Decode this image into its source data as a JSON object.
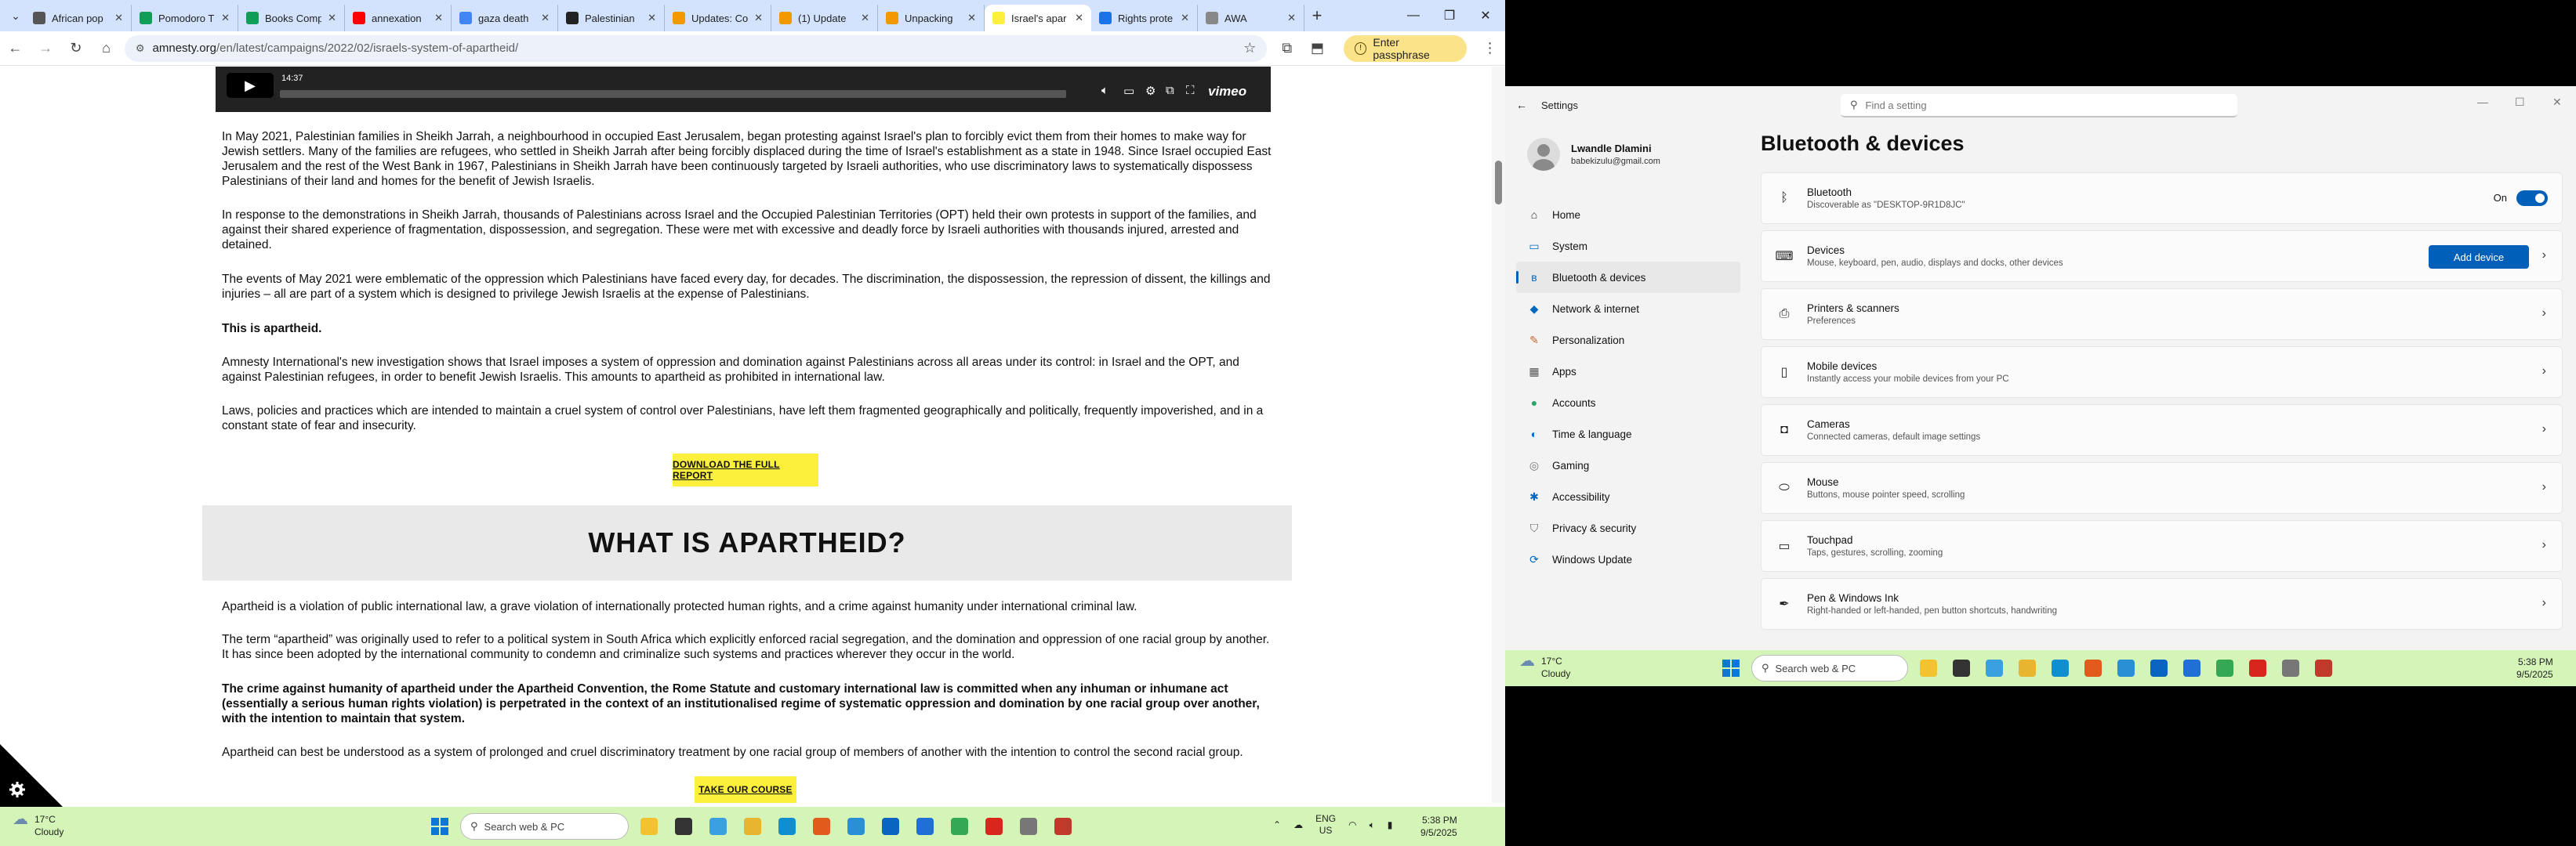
{
  "browser": {
    "tabs": [
      {
        "title": "African pop",
        "color": "#555"
      },
      {
        "title": "Pomodoro T",
        "color": "#0f9d58"
      },
      {
        "title": "Books Comp",
        "color": "#0f9d58"
      },
      {
        "title": "annexation",
        "color": "#ff0000"
      },
      {
        "title": "gaza death",
        "color": "#4285f4"
      },
      {
        "title": "Palestinian",
        "color": "#222"
      },
      {
        "title": "Updates: Co",
        "color": "#f29900"
      },
      {
        "title": "(1) Update",
        "color": "#f29900"
      },
      {
        "title": "Unpacking",
        "color": "#f29900"
      },
      {
        "title": "Israel's apar",
        "color": "#fdf03c"
      },
      {
        "title": "Rights prote",
        "color": "#1a73e8"
      },
      {
        "title": "AWA",
        "color": "#888"
      }
    ],
    "new_tab": "+",
    "url_host": "amnesty.org",
    "url_path": "/en/latest/campaigns/2022/02/israels-system-of-apartheid/",
    "passphrase_button": "Enter passphrase"
  },
  "video": {
    "time": "14:37",
    "brand": "vimeo"
  },
  "article": {
    "p1": "In May 2021, Palestinian families in Sheikh Jarrah, a neighbourhood in occupied East Jerusalem, began protesting against Israel's plan to forcibly evict them from their homes to make way for Jewish settlers. Many of the families are refugees, who settled in Sheikh Jarrah after being forcibly displaced during the time of Israel's establishment as a state in 1948.  Since Israel occupied East Jerusalem and the rest of the West Bank in 1967, Palestinians in Sheikh Jarrah have been continuously targeted by Israeli authorities, who use discriminatory laws to systematically dispossess Palestinians of their land and homes for the benefit of Jewish Israelis.",
    "p2": "In response to the demonstrations in Sheikh Jarrah, thousands of Palestinians across Israel and the Occupied Palestinian Territories (OPT) held their own protests in support of the families, and against their shared experience of fragmentation, dispossession, and segregation. These were met with excessive and deadly force by Israeli authorities with thousands injured, arrested and detained.",
    "p3": "The events of May 2021 were emblematic of the oppression which Palestinians have faced every day, for decades. The discrimination, the dispossession, the repression of dissent, the killings and injuries – all are part of a system which is designed to privilege Jewish Israelis at the expense of Palestinians.",
    "p4": "This is apartheid.",
    "p5": "Amnesty International's new investigation shows that Israel imposes a system of oppression and domination against Palestinians across all areas under its control: in Israel and the OPT, and against Palestinian refugees, in order to benefit Jewish Israelis. This amounts to apartheid as prohibited in international law.",
    "p6": "Laws, policies and practices which are intended to maintain a cruel system of control over Palestinians, have left them fragmented geographically and politically, frequently impoverished, and in a constant state of fear and insecurity.",
    "cta1": "DOWNLOAD THE FULL REPORT",
    "heading": "WHAT IS APARTHEID?",
    "p7": "Apartheid is a violation of public international law, a grave violation of internationally protected human rights, and a crime against humanity under international criminal law.",
    "p8": "The term “apartheid” was originally used to refer to a political system in South Africa which explicitly enforced racial segregation, and the domination and oppression of one racial group by another. It has since been adopted by the international community to condemn and criminalize such systems and practices wherever they occur in the world.",
    "p9": "The crime against humanity of apartheid under the Apartheid Convention, the Rome Statute and customary international law is committed when any inhuman or inhumane act (essentially a serious human rights violation) is perpetrated in the context of an institutionalised regime of systematic oppression and domination by one racial group over another, with the intention to maintain that system.",
    "p10": "Apartheid can best be understood as a system of prolonged and cruel discriminatory treatment by one racial group of members of another with the intention to control the second racial group.",
    "cta2": "TAKE OUR COURSE"
  },
  "taskbar_left": {
    "temp": "17°C",
    "weather": "Cloudy",
    "search": "Search web & PC",
    "lang1": "ENG",
    "lang2": "US",
    "time": "5:38 PM",
    "date": "9/5/2025"
  },
  "settings": {
    "window_title": "Settings",
    "search_placeholder": "Find a setting",
    "user_name": "Lwandle Dlamini",
    "user_email": "babekizulu@gmail.com",
    "page_title": "Bluetooth & devices",
    "nav": [
      {
        "label": "Home",
        "icon": "home-icon",
        "glyph": "⌂",
        "color": "#333"
      },
      {
        "label": "System",
        "icon": "system-icon",
        "glyph": "▭",
        "color": "#0067c0"
      },
      {
        "label": "Bluetooth & devices",
        "icon": "bluetooth-icon",
        "glyph": "ʙ",
        "color": "#0067c0"
      },
      {
        "label": "Network & internet",
        "icon": "network-icon",
        "glyph": "◆",
        "color": "#0067c0"
      },
      {
        "label": "Personalization",
        "icon": "brush-icon",
        "glyph": "✎",
        "color": "#c0652d"
      },
      {
        "label": "Apps",
        "icon": "apps-icon",
        "glyph": "▦",
        "color": "#555"
      },
      {
        "label": "Accounts",
        "icon": "accounts-icon",
        "glyph": "●",
        "color": "#2ca56b"
      },
      {
        "label": "Time & language",
        "icon": "globe-icon",
        "glyph": "◐",
        "color": "#0067c0"
      },
      {
        "label": "Gaming",
        "icon": "gaming-icon",
        "glyph": "◎",
        "color": "#777"
      },
      {
        "label": "Accessibility",
        "icon": "accessibility-icon",
        "glyph": "✱",
        "color": "#0067c0"
      },
      {
        "label": "Privacy & security",
        "icon": "shield-icon",
        "glyph": "⛉",
        "color": "#666"
      },
      {
        "label": "Windows Update",
        "icon": "update-icon",
        "glyph": "⟳",
        "color": "#0067c0"
      }
    ],
    "bluetooth": {
      "title": "Bluetooth",
      "sub": "Discoverable as \"DESKTOP-9R1D8JC\"",
      "state": "On"
    },
    "devices": {
      "title": "Devices",
      "sub": "Mouse, keyboard, pen, audio, displays and docks, other devices",
      "button": "Add device"
    },
    "cards": [
      {
        "title": "Printers & scanners",
        "sub": "Preferences",
        "icon": "printer-icon",
        "glyph": "⎙"
      },
      {
        "title": "Mobile devices",
        "sub": "Instantly access your mobile devices from your PC",
        "icon": "phone-icon",
        "glyph": "▯"
      },
      {
        "title": "Cameras",
        "sub": "Connected cameras, default image settings",
        "icon": "camera-icon",
        "glyph": "◘"
      },
      {
        "title": "Mouse",
        "sub": "Buttons, mouse pointer speed, scrolling",
        "icon": "mouse-icon",
        "glyph": "⬭"
      },
      {
        "title": "Touchpad",
        "sub": "Taps, gestures, scrolling, zooming",
        "icon": "touchpad-icon",
        "glyph": "▭"
      },
      {
        "title": "Pen & Windows Ink",
        "sub": "Right-handed or left-handed, pen button shortcuts, handwriting",
        "icon": "pen-icon",
        "glyph": "✒"
      }
    ]
  },
  "taskbar_right": {
    "temp": "17°C",
    "weather": "Cloudy",
    "search": "Search web & PC",
    "time": "5:38 PM",
    "date": "9/5/2025"
  },
  "taskbar_apps": [
    {
      "name": "file-explorer-icon",
      "color": "#f2c230"
    },
    {
      "name": "task-view-icon",
      "color": "#333"
    },
    {
      "name": "copilot-icon",
      "color": "#3aa0e0"
    },
    {
      "name": "folder-icon",
      "color": "#e8b530"
    },
    {
      "name": "edge-icon",
      "color": "#0f8fcf"
    },
    {
      "name": "brave-icon",
      "color": "#e25a1c"
    },
    {
      "name": "vscode-icon",
      "color": "#2b8fd6"
    },
    {
      "name": "outlook-icon",
      "color": "#0a64c2"
    },
    {
      "name": "store-icon",
      "color": "#1f6fd6"
    },
    {
      "name": "chrome-icon",
      "color": "#34a853"
    },
    {
      "name": "acrobat-icon",
      "color": "#d9261c"
    },
    {
      "name": "settings-app-icon",
      "color": "#777"
    },
    {
      "name": "app-icon",
      "color": "#c0392b"
    }
  ]
}
